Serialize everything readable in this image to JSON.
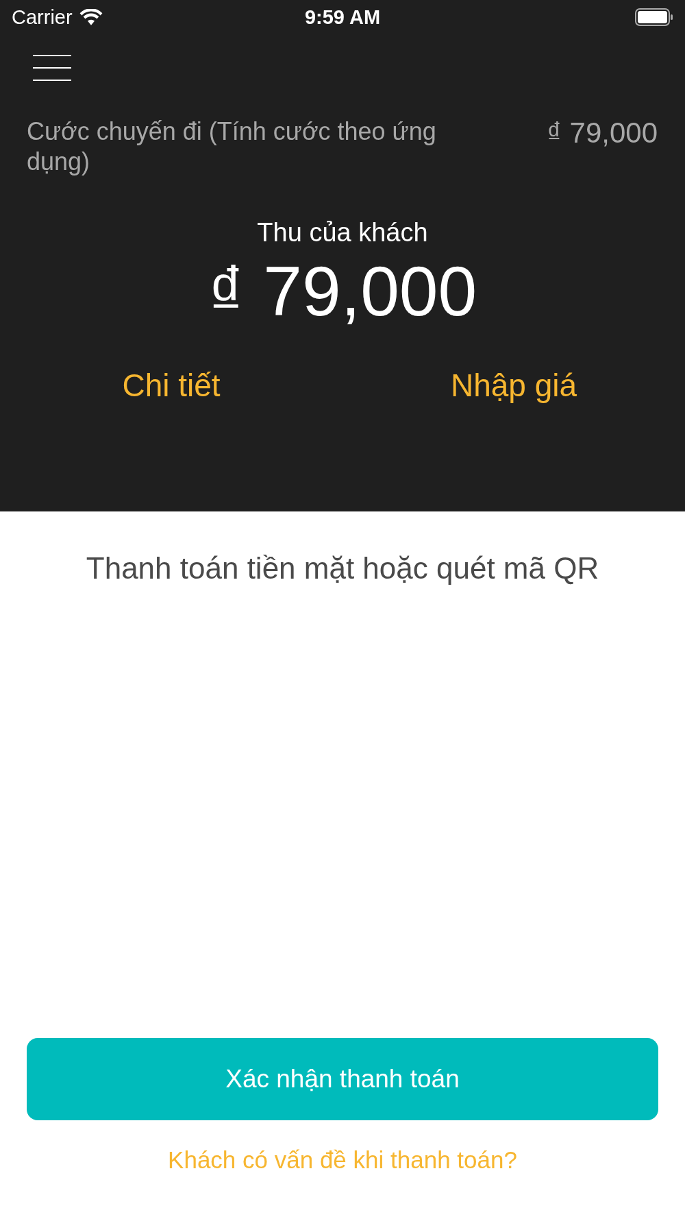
{
  "status_bar": {
    "carrier": "Carrier",
    "time": "9:59 AM"
  },
  "fare": {
    "label": "Cước chuyến đi (Tính cước theo ứng dụng)",
    "amount": "₫ 79,000"
  },
  "collected": {
    "label": "Thu của khách",
    "amount": "₫ 79,000"
  },
  "actions": [
    {
      "label": "Chi tiết"
    },
    {
      "label": "Nhập giá"
    }
  ],
  "payment_prompt": "Thanh toán tiền mặt hoặc quét mã QR",
  "confirm_button": "Xác nhận thanh toán",
  "problem_link": "Khách có vấn đề khi thanh toán?"
}
